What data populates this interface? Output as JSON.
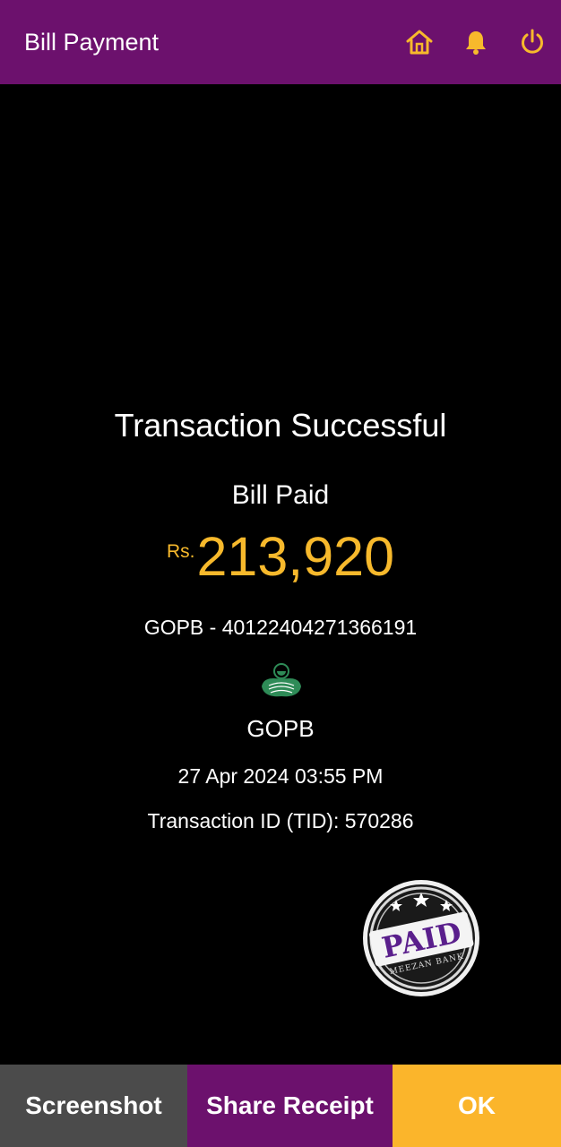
{
  "header": {
    "title": "Bill Payment",
    "icons": [
      "home-icon",
      "bell-icon",
      "power-icon"
    ],
    "accent_color": "#f7b92c",
    "bar_color": "#6c116d"
  },
  "receipt": {
    "status": "Transaction Successful",
    "subtitle": "Bill Paid",
    "currency": "Rs.",
    "amount": "213,920",
    "reference": "GOPB - 40122404271366191",
    "biller_name": "GOPB",
    "datetime": "27 Apr 2024 03:55 PM",
    "transaction_id": "Transaction ID (TID): 570286"
  },
  "stamp": {
    "text": "PAID",
    "bank": "MEEZAN BANK"
  },
  "actions": {
    "screenshot_label": "Screenshot",
    "share_label": "Share Receipt",
    "ok_label": "OK"
  }
}
